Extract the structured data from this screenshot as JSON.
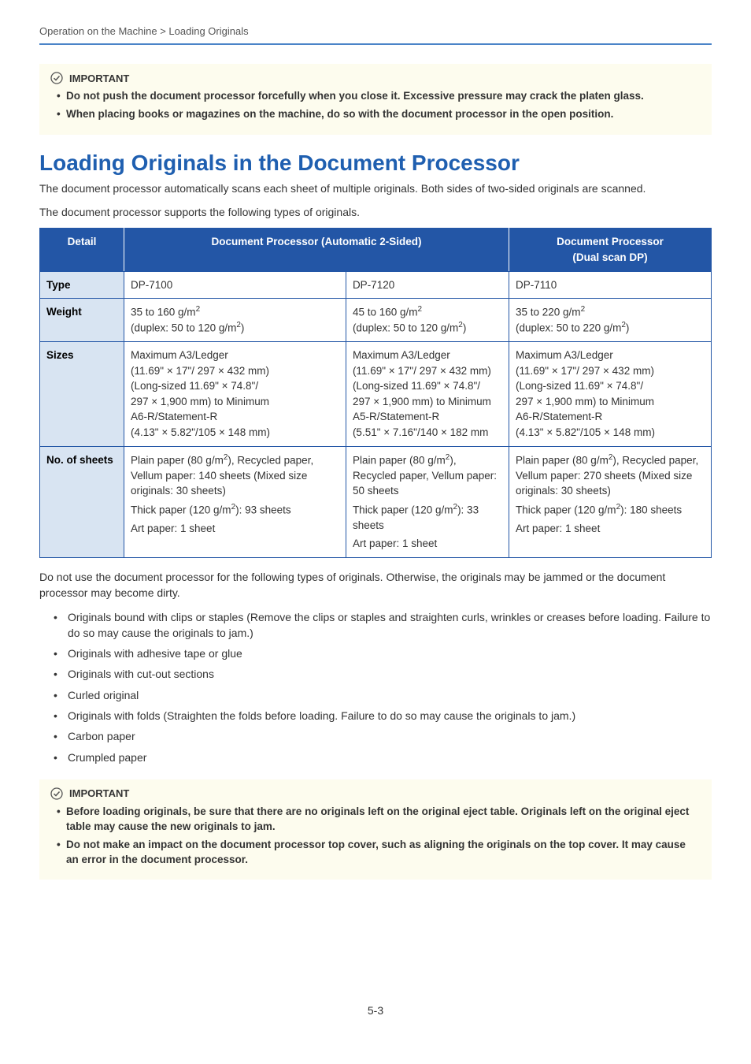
{
  "breadcrumb": "Operation on the Machine > Loading Originals",
  "important_label": "IMPORTANT",
  "callout1": {
    "items": [
      "Do not push the document processor forcefully when you close it. Excessive pressure may crack the platen glass.",
      "When placing books or magazines on the machine, do so with the document processor in the open position."
    ]
  },
  "heading": "Loading Originals in the Document Processor",
  "intro1": "The document processor automatically scans each sheet of multiple originals. Both sides of two-sided originals are scanned.",
  "intro2": "The document processor supports the following types of originals.",
  "table": {
    "headers": {
      "detail": "Detail",
      "auto2": "Document Processor (Automatic 2-Sided)",
      "dual": "Document Processor\n(Dual scan DP)"
    },
    "rows": {
      "type": {
        "label": "Type",
        "c1": "DP-7100",
        "c2": "DP-7120",
        "c3": "DP-7110"
      },
      "weight": {
        "label": "Weight",
        "c1": {
          "line1_prefix": "35 to 160 g/m",
          "line2_prefix": "(duplex: 50 to 120 g/m",
          "line2_suffix": ")"
        },
        "c2": {
          "line1_prefix": "45 to 160 g/m",
          "line2_prefix": "(duplex: 50 to 120 g/m",
          "line2_suffix": ")"
        },
        "c3": {
          "line1_prefix": "35 to 220 g/m",
          "line2_prefix": "(duplex: 50 to 220 g/m",
          "line2_suffix": ")"
        }
      },
      "sizes": {
        "label": "Sizes",
        "c1": {
          "l1": "Maximum A3/Ledger",
          "l2": "(11.69\" × 17\"/ 297 × 432 mm)",
          "l3": "(Long-sized 11.69\" × 74.8\"/",
          "l4": "297  ×  1,900  mm) to Minimum",
          "l5": "A6-R/Statement-R",
          "l6": "(4.13\" × 5.82\"/105 × 148 mm)"
        },
        "c2": {
          "l1": "Maximum A3/Ledger",
          "l2": "(11.69\" × 17\"/ 297 × 432 mm)",
          "l3": "(Long-sized 11.69\" × 74.8\"/",
          "l4": "297  ×  1,900  mm) to Minimum",
          "l5": "A5-R/Statement-R",
          "l6": "(5.51\" × 7.16\"/140 × 182 mm"
        },
        "c3": {
          "l1": "Maximum A3/Ledger",
          "l2": "(11.69\" × 17\"/ 297 × 432 mm)",
          "l3": "(Long-sized 11.69\" × 74.8\"/",
          "l4": "297  ×  1,900  mm) to Minimum",
          "l5": "A6-R/Statement-R",
          "l6": "(4.13\" × 5.82\"/105 × 148 mm)"
        }
      },
      "sheets": {
        "label": "No. of sheets",
        "c1": {
          "p1_prefix": "Plain paper (80 g/m",
          "p1_suffix": "), Recycled paper, Vellum paper: 140 sheets (Mixed size originals: 30 sheets)",
          "p2_prefix": "Thick paper (120 g/m",
          "p2_suffix": "): 93 sheets",
          "p3": "Art paper: 1 sheet"
        },
        "c2": {
          "p1_prefix": "Plain paper (80 g/m",
          "p1_suffix": "), Recycled paper, Vellum paper: 50 sheets",
          "p2_prefix": "Thick paper (120 g/m",
          "p2_suffix": "): 33 sheets",
          "p3": "Art paper: 1 sheet"
        },
        "c3": {
          "p1_prefix": "Plain paper (80 g/m",
          "p1_suffix": "), Recycled paper, Vellum paper: 270 sheets (Mixed size originals: 30 sheets)",
          "p2_prefix": "Thick paper (120 g/m",
          "p2_suffix": "): 180 sheets",
          "p3": "Art paper: 1 sheet"
        }
      }
    }
  },
  "warn_intro": "Do not use the document processor for the following types of originals. Otherwise, the originals may be jammed or the document processor may become dirty.",
  "warn_list": [
    "Originals bound with clips or staples (Remove the clips or staples and straighten curls, wrinkles or creases before loading. Failure to do so may cause the originals to jam.)",
    "Originals with adhesive tape or glue",
    "Originals with cut-out sections",
    "Curled original",
    "Originals with folds (Straighten the folds before loading. Failure to do so may cause the originals to jam.)",
    "Carbon paper",
    "Crumpled paper"
  ],
  "callout2": {
    "items": [
      "Before loading originals, be sure that there are no originals left on the original eject table. Originals left on the original eject table may cause the new originals to jam.",
      "Do not make an impact on the document processor top cover, such as aligning the originals on the top cover. It may cause an error in the document processor."
    ]
  },
  "page_number": "5-3"
}
